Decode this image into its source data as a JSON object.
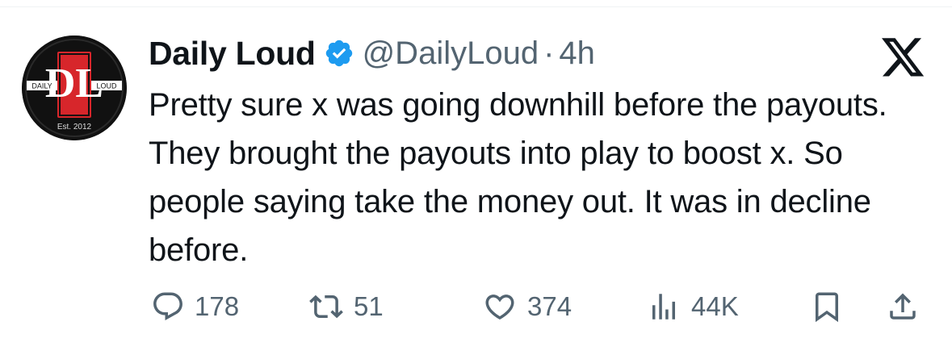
{
  "tweet": {
    "avatar": {
      "left_word": "DAILY",
      "right_word": "LOUD",
      "est": "Est. 2012",
      "monogram": "DL"
    },
    "display_name": "Daily Loud",
    "handle": "@DailyLoud",
    "separator": "·",
    "timestamp": "4h",
    "text": "Pretty sure x was going downhill before the payouts. They brought the payouts into play to boost x. So people saying take the money out. It was in decline before."
  },
  "actions": {
    "replies": "178",
    "reposts": "51",
    "likes": "374",
    "views": "44K"
  },
  "icons": {
    "verified": "verified-badge-icon",
    "platform": "x-logo-icon",
    "reply": "reply-icon",
    "repost": "repost-icon",
    "like": "heart-icon",
    "views": "views-icon",
    "bookmark": "bookmark-icon",
    "share": "share-icon"
  },
  "colors": {
    "text": "#0f1419",
    "secondary": "#536471",
    "verified": "#1d9bf0",
    "avatar_red": "#d7262b",
    "background": "#ffffff"
  }
}
